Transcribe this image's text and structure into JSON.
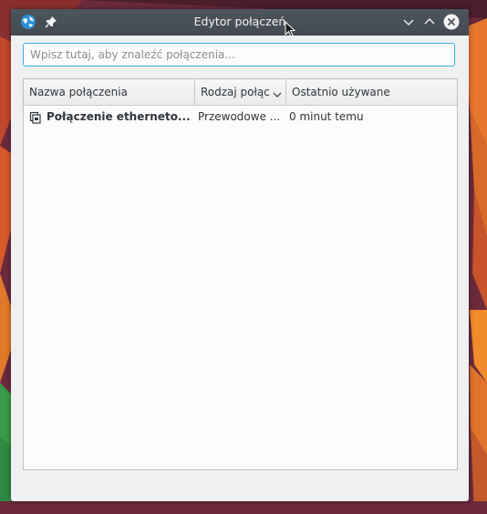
{
  "window": {
    "title": "Edytor połączeń"
  },
  "search": {
    "placeholder": "Wpisz tutaj, aby znaleźć połączenia...",
    "value": ""
  },
  "table": {
    "columns": [
      {
        "label": "Nazwa połączenia"
      },
      {
        "label": "Rodzaj połąc"
      },
      {
        "label": "Ostatnio używane"
      }
    ],
    "sort_column": 1,
    "rows": [
      {
        "icon": "network-wired-icon",
        "name": "Połączenie etherneto...",
        "type": "Przewodowe ...",
        "last_used": "0 minut temu"
      }
    ]
  },
  "colors": {
    "accent": "#3daee9",
    "titlebar": "#474e55",
    "window_bg": "#eff0f1"
  }
}
